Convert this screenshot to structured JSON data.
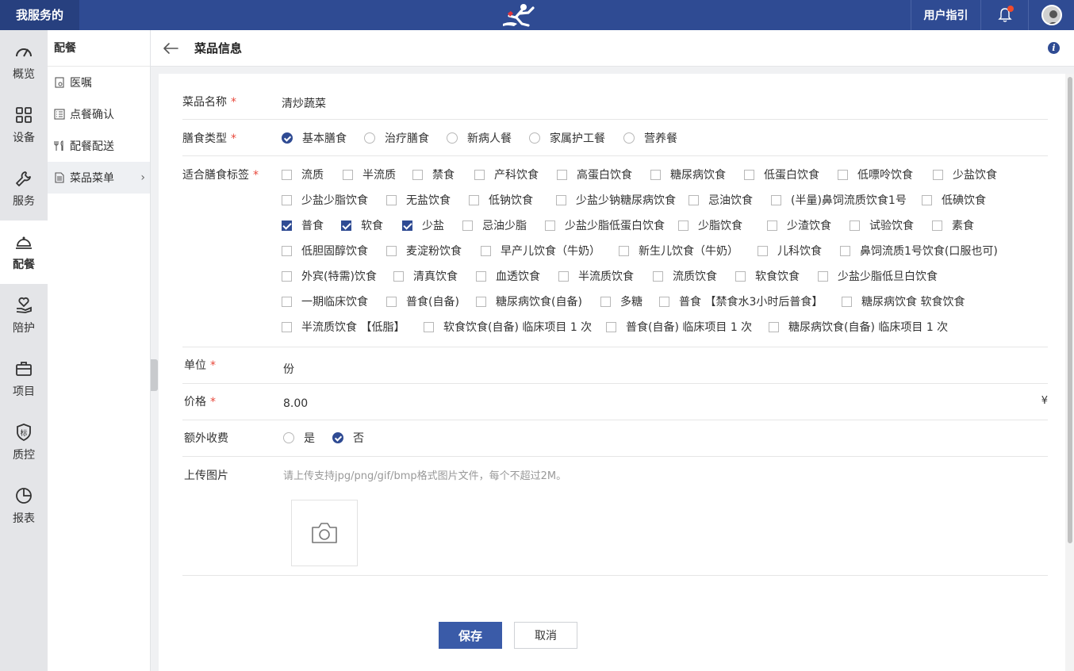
{
  "topbar": {
    "brand": "我服务的",
    "guide": "用户指引"
  },
  "rail": [
    {
      "label": "概览",
      "icon": "dashboard-icon"
    },
    {
      "label": "设备",
      "icon": "grid-icon"
    },
    {
      "label": "服务",
      "icon": "wrench-icon"
    },
    {
      "label": "配餐",
      "icon": "cloche-icon"
    },
    {
      "label": "陪护",
      "icon": "heart-hand-icon"
    },
    {
      "label": "项目",
      "icon": "briefcase-icon"
    },
    {
      "label": "质控",
      "icon": "shield-icon"
    },
    {
      "label": "报表",
      "icon": "pie-icon"
    }
  ],
  "submenu": {
    "title": "配餐",
    "items": [
      {
        "label": "医嘱",
        "icon": "doc-add-icon"
      },
      {
        "label": "点餐确认",
        "icon": "list-icon"
      },
      {
        "label": "配餐配送",
        "icon": "utensils-icon"
      },
      {
        "label": "菜品菜单",
        "icon": "document-icon"
      }
    ]
  },
  "header": {
    "title": "菜品信息"
  },
  "form": {
    "name": {
      "label": "菜品名称",
      "value": "清炒蔬菜"
    },
    "diet_type": {
      "label": "膳食类型",
      "options": [
        "基本膳食",
        "治疗膳食",
        "新病人餐",
        "家属护工餐",
        "营养餐"
      ],
      "selected": "基本膳食"
    },
    "tags": {
      "label": "适合膳食标签",
      "rows": [
        [
          "流质",
          "半流质",
          "禁食",
          "产科饮食",
          "高蛋白饮食",
          "糖尿病饮食",
          "低蛋白饮食",
          "低嘌呤饮食",
          "少盐饮食"
        ],
        [
          "少盐少脂饮食",
          "无盐饮食",
          "低钠饮食",
          "少盐少钠糖尿病饮食",
          "忌油饮食",
          "(半量)鼻饲流质饮食1号",
          "低碘饮食"
        ],
        [
          "普食",
          "软食",
          "少盐",
          "忌油少脂",
          "少盐少脂低蛋白饮食",
          "少脂饮食",
          "少渣饮食",
          "试验饮食",
          "素食"
        ],
        [
          "低胆固醇饮食",
          "麦淀粉饮食",
          "早产儿饮食（牛奶）",
          "新生儿饮食（牛奶）",
          "儿科饮食",
          "鼻饲流质1号饮食(口服也可)"
        ],
        [
          "外宾(特需)饮食",
          "清真饮食",
          "血透饮食",
          "半流质饮食",
          "流质饮食",
          "软食饮食",
          "少盐少脂低旦白饮食"
        ],
        [
          "一期临床饮食",
          "普食(自备)",
          "糖尿病饮食(自备)",
          "多糖",
          "普食 【禁食水3小时后普食】",
          "糖尿病饮食 软食饮食"
        ],
        [
          "半流质饮食 【低脂】",
          "软食饮食(自备) 临床项目 1 次",
          "普食(自备) 临床项目 1 次",
          "糖尿病饮食(自备) 临床项目 1 次"
        ]
      ],
      "checked": [
        "普食",
        "软食",
        "少盐"
      ]
    },
    "unit": {
      "label": "单位",
      "value": "份"
    },
    "price": {
      "label": "价格",
      "value": "8.00",
      "currency": "¥"
    },
    "extra_fee": {
      "label": "额外收费",
      "options": [
        "是",
        "否"
      ],
      "selected": "否"
    },
    "upload": {
      "label": "上传图片",
      "hint": "请上传支持jpg/png/gif/bmp格式图片文件，每个不超过2M。"
    }
  },
  "buttons": {
    "save": "保存",
    "cancel": "取消"
  },
  "colors": {
    "primary": "#2f4b93",
    "required": "#e8483b",
    "notify": "#f24b2c"
  }
}
